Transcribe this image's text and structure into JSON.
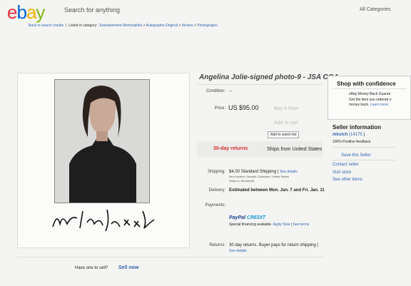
{
  "header": {
    "logo": [
      "e",
      "b",
      "a",
      "y"
    ],
    "logo_colors": [
      "#e53238",
      "#0064d2",
      "#f5af02",
      "#86b817"
    ],
    "search_placeholder": "Search for anything",
    "all_categories": "All Categories"
  },
  "breadcrumb": {
    "back": "Back to search results",
    "sep1": "|",
    "listed": "Listed in category:",
    "items": [
      "Entertainment Memorabilia",
      ">",
      "Autographs-Original",
      ">",
      "Movies",
      ">",
      "Photographs"
    ]
  },
  "listing": {
    "title": "Angelina Jolie-signed photo-9 - JSA COA",
    "condition_label": "Condition:",
    "condition_value": "--",
    "price_label": "Price:",
    "price": "US $95.00",
    "buy_now": "Buy It Now",
    "add_to_cart": "Add to cart",
    "add_watch": "Add to watch list",
    "returns_badge": "30-day returns",
    "ships_from": "Ships from United States"
  },
  "shipping": {
    "label": "Shipping:",
    "cost": "$4.00",
    "method": "Standard Shipping",
    "see_details": "See details",
    "item_location": "Item location: Newark, Delaware, United States",
    "ships_to": "Ships to: Worldwide"
  },
  "delivery": {
    "label": "Delivery:",
    "text": "Estimated between Mon. Jan. 7 and Fri. Jan. 11"
  },
  "payments": {
    "label": "Payments:",
    "paypal_a": "PayPal",
    "paypal_b": " CREDIT",
    "financing": "Special financing available.",
    "apply": "Apply Now",
    "sep": "|",
    "terms": "See terms"
  },
  "returns": {
    "label": "Returns:",
    "text": "30 day returns. Buyer pays for return shipping |",
    "see_details": "See details"
  },
  "sell": {
    "question": "Have one to sell?",
    "link": "Sell now"
  },
  "confidence": {
    "title": "Shop with confidence",
    "line1": "eBay Money Back Guaran",
    "line2": "Get the item you ordered o",
    "line3": "money back.",
    "learn": "Learn more"
  },
  "seller": {
    "title": "Seller information",
    "name": "mkutch",
    "score": "(14175",
    "score_end": ")",
    "feedback": "100% Positive feedback",
    "save": "Save this Seller",
    "contact": "Contact seller",
    "visit": "Visit store",
    "other": "See other items"
  }
}
